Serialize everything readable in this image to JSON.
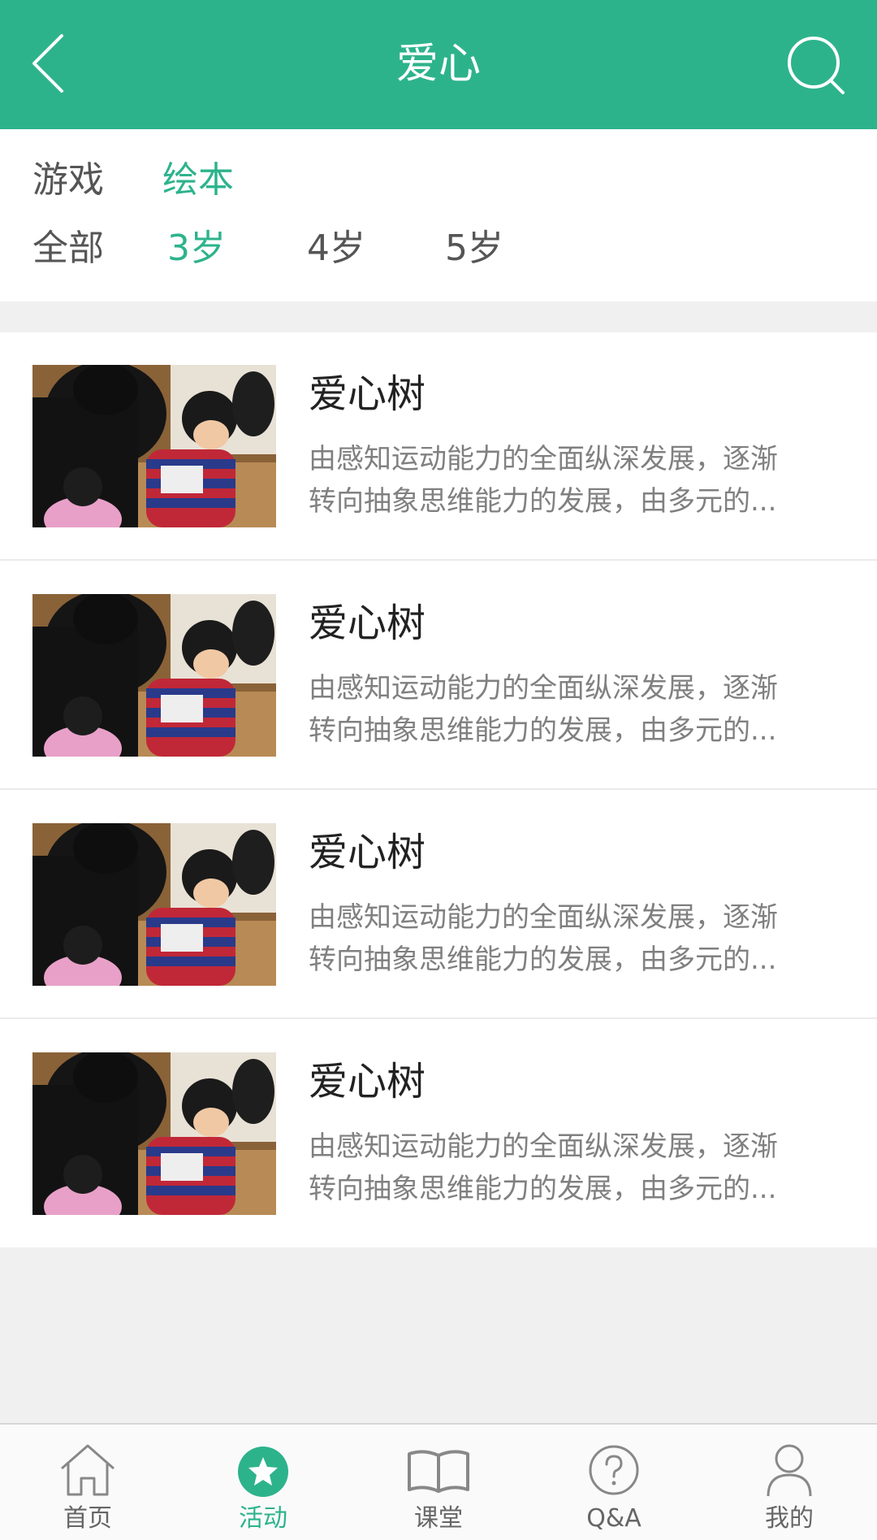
{
  "header": {
    "title": "爱心",
    "back_icon": "chevron-left-icon",
    "search_icon": "search-icon",
    "background": "#2db38c"
  },
  "filters": {
    "type_row": [
      {
        "label": "游戏",
        "active": false
      },
      {
        "label": "绘本",
        "active": true
      }
    ],
    "age_row": [
      {
        "label": "全部",
        "active": false
      },
      {
        "label": "3岁",
        "active": true
      },
      {
        "label": "4岁",
        "active": false
      },
      {
        "label": "5岁",
        "active": false
      }
    ]
  },
  "items": [
    {
      "title": "爱心树",
      "desc_line1": "由感知运动能力的全面纵深发展，逐渐",
      "desc_line2": "转向抽象思维能力的发展，由多元的..."
    },
    {
      "title": "爱心树",
      "desc_line1": "由感知运动能力的全面纵深发展，逐渐",
      "desc_line2": "转向抽象思维能力的发展，由多元的..."
    },
    {
      "title": "爱心树",
      "desc_line1": "由感知运动能力的全面纵深发展，逐渐",
      "desc_line2": "转向抽象思维能力的发展，由多元的..."
    },
    {
      "title": "爱心树",
      "desc_line1": "由感知运动能力的全面纵深发展，逐渐",
      "desc_line2": "转向抽象思维能力的发展，由多元的..."
    }
  ],
  "tabs": [
    {
      "label": "首页",
      "icon": "home-icon",
      "active": false
    },
    {
      "label": "活动",
      "icon": "star-icon",
      "active": true
    },
    {
      "label": "课堂",
      "icon": "book-icon",
      "active": false
    },
    {
      "label": "Q&A",
      "icon": "question-icon",
      "active": false
    },
    {
      "label": "我的",
      "icon": "user-icon",
      "active": false
    }
  ],
  "colors": {
    "accent": "#2db38c",
    "text_dark": "#222222",
    "text_gray": "#808080"
  }
}
